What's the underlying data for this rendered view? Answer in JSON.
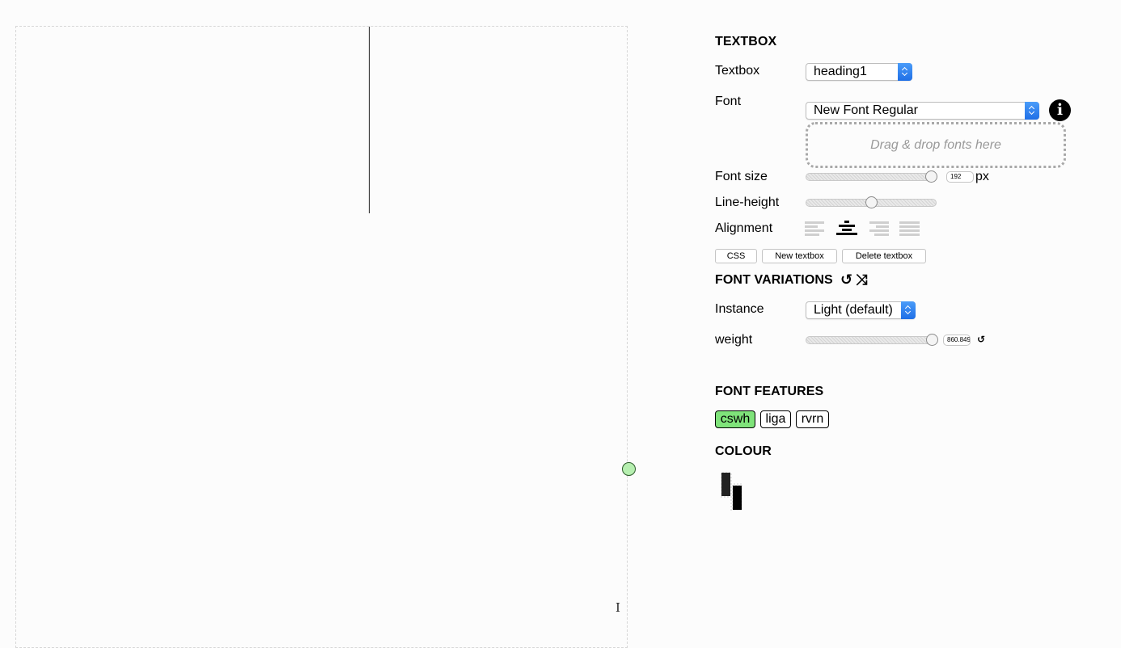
{
  "canvas": {
    "text_cursor_glyph": "I"
  },
  "textbox_section": {
    "heading": "TEXTBOX",
    "textbox_label": "Textbox",
    "textbox_value": "heading1",
    "font_label": "Font",
    "font_value": "New Font Regular",
    "info_icon": "i",
    "dropzone_text": "Drag & drop fonts here",
    "font_size_label": "Font size",
    "font_size_value": "192",
    "font_size_unit": "px",
    "font_size_fraction": 0.96,
    "line_height_label": "Line-height",
    "line_height_fraction": 0.5,
    "alignment_label": "Alignment",
    "alignment_options": [
      "left",
      "center",
      "right",
      "justify"
    ],
    "alignment_selected": "center",
    "css_button": "CSS",
    "new_textbox_button": "New textbox",
    "delete_textbox_button": "Delete textbox"
  },
  "variations_section": {
    "heading": "FONT VARIATIONS",
    "reset_icon": "↺",
    "shuffle_icon": "⤨",
    "instance_label": "Instance",
    "instance_value": "Light (default)",
    "weight_label": "weight",
    "weight_value": "860.849",
    "weight_fraction": 0.97,
    "weight_reset_icon": "↺"
  },
  "features_section": {
    "heading": "FONT FEATURES",
    "features": [
      {
        "label": "cswh",
        "active": true
      },
      {
        "label": "liga",
        "active": false
      },
      {
        "label": "rvrn",
        "active": false
      }
    ]
  },
  "colour_section": {
    "heading": "COLOUR",
    "foreground": "#222222",
    "background": "#000000"
  },
  "colors": {
    "accent_blue": "#1f6fe6",
    "feature_on": "#7fe37a",
    "handle_green": "#b6efb0"
  }
}
